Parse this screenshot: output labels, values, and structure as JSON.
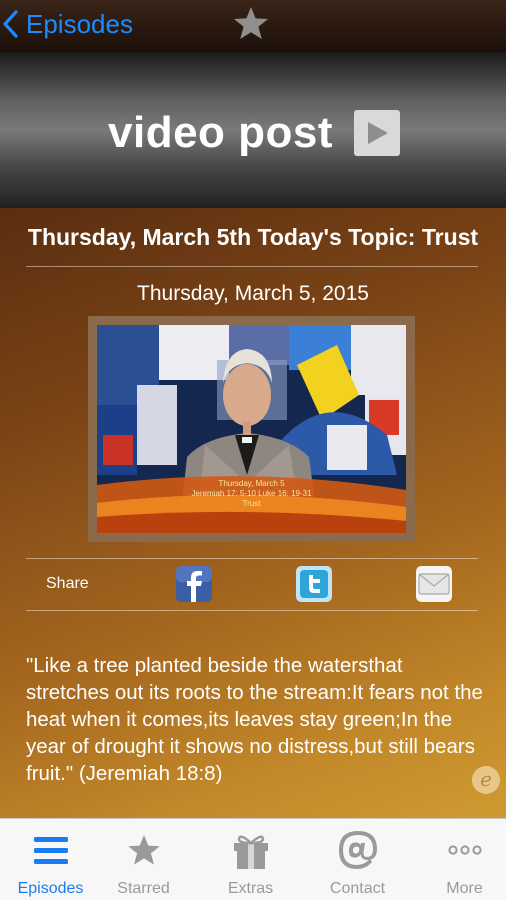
{
  "navbar": {
    "back_label": "Episodes"
  },
  "banner": {
    "title": "video post"
  },
  "post": {
    "title": "Thursday, March 5th Today's Topic: Trust",
    "date": "Thursday, March 5, 2015",
    "video_caption": [
      "Thursday, March 5",
      "Jeremiah 17: 5-10  Luke 16: 19-31",
      "Trust"
    ]
  },
  "share": {
    "label": "Share"
  },
  "quote": "\"Like a tree planted beside the watersthat stretches out its roots to the stream:It fears not the heat when it comes,its leaves stay green;In the year of drought it shows no distress,but still bears fruit.\" (Jeremiah 18:8)",
  "badge": "e",
  "tabs": [
    {
      "label": "Episodes",
      "icon": "list-icon",
      "active": true
    },
    {
      "label": "Starred",
      "icon": "star-icon",
      "active": false
    },
    {
      "label": "Extras",
      "icon": "gift-icon",
      "active": false
    },
    {
      "label": "Contact",
      "icon": "at-icon",
      "active": false
    },
    {
      "label": "More",
      "icon": "more-icon",
      "active": false
    }
  ],
  "colors": {
    "accent": "#1a8cff",
    "tab_active": "#1a7cf0",
    "tab_inactive": "#9a9a9a"
  }
}
